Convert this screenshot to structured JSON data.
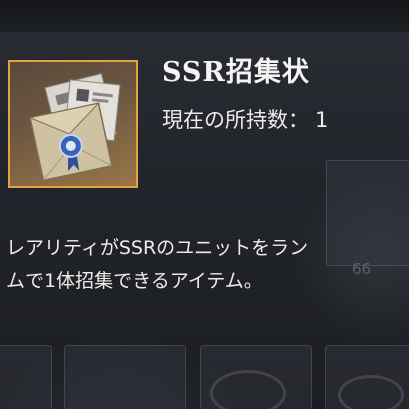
{
  "item": {
    "name": "SSR招集状",
    "owned_label": "現在の所持数：",
    "owned_count": "1",
    "icon": "ssr-recruitment-letter-icon",
    "frame_color": "#e3a33d"
  },
  "description": {
    "line1": "レアリティがSSRのユニットをラン",
    "line2": "ムで1体招集できるアイテム。"
  },
  "background": {
    "slot_count_text": "66"
  }
}
